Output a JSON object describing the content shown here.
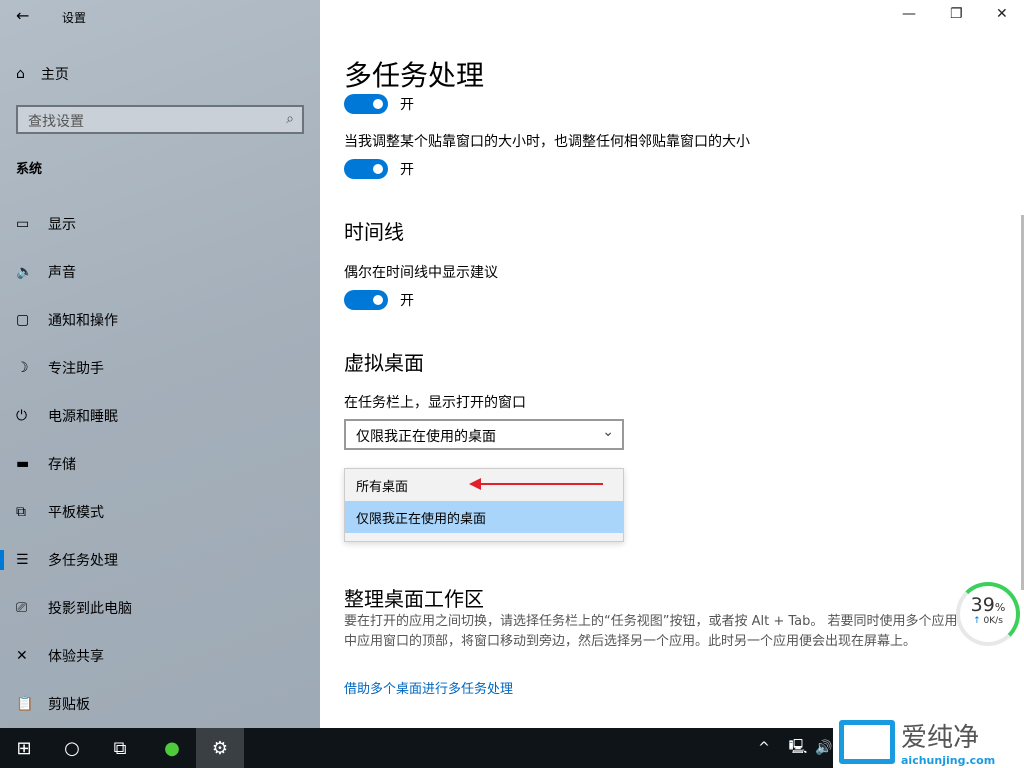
{
  "app_title": "设置",
  "sidebar": {
    "home": "主页",
    "search_placeholder": "查找设置",
    "section": "系统",
    "items": [
      {
        "icon": "display-icon",
        "glyph": "▭",
        "label": "显示"
      },
      {
        "icon": "sound-icon",
        "glyph": "🔈",
        "label": "声音"
      },
      {
        "icon": "notification-icon",
        "glyph": "▢",
        "label": "通知和操作"
      },
      {
        "icon": "focus-icon",
        "glyph": "☽",
        "label": "专注助手"
      },
      {
        "icon": "power-icon",
        "glyph": "⏻",
        "label": "电源和睡眠"
      },
      {
        "icon": "storage-icon",
        "glyph": "▬",
        "label": "存储"
      },
      {
        "icon": "tablet-icon",
        "glyph": "⧉",
        "label": "平板模式"
      },
      {
        "icon": "multitasking-icon",
        "glyph": "☰",
        "label": "多任务处理",
        "active": true
      },
      {
        "icon": "project-icon",
        "glyph": "⎚",
        "label": "投影到此电脑"
      },
      {
        "icon": "share-icon",
        "glyph": "✕",
        "label": "体验共享"
      },
      {
        "icon": "clipboard-icon",
        "glyph": "📋",
        "label": "剪贴板"
      }
    ]
  },
  "main": {
    "title": "多任务处理",
    "toggle1": "开",
    "snap_label": "当我调整某个贴靠窗口的大小时，也调整任何相邻贴靠窗口的大小",
    "toggle2": "开",
    "timeline_heading": "时间线",
    "timeline_label": "偶尔在时间线中显示建议",
    "toggle3": "开",
    "vd_heading": "虚拟桌面",
    "vd_label": "在任务栏上，显示打开的窗口",
    "select_value": "仅限我正在使用的桌面",
    "options": [
      "所有桌面",
      "仅限我正在使用的桌面"
    ],
    "arrange_heading": "整理桌面工作区",
    "arrange_desc": "要在打开的应用之间切换，请选择任务栏上的“任务视图”按钮，或者按 Alt + Tab。 若要同时使用多个应用，请选中应用窗口的顶部，将窗口移动到旁边，然后选择另一个应用。此时另一个应用便会出现在屏幕上。",
    "link": "借助多个桌面进行多任务处理"
  },
  "gauge": {
    "percent": "39",
    "unit": "%",
    "speed": "0K/s"
  },
  "watermark": {
    "name": "爱纯净",
    "url": "aichunjing.com"
  },
  "colors": {
    "accent": "#0078d7",
    "selected_option": "#a9d5fb",
    "arrow": "#e0202a"
  }
}
